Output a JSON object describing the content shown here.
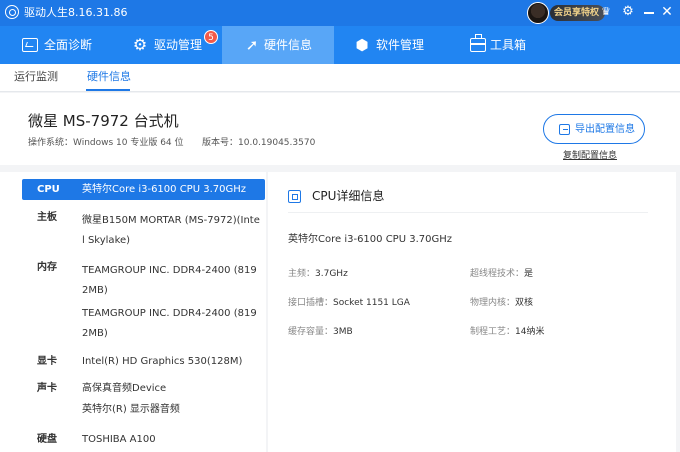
{
  "app": {
    "title": "驱动人生8.16.31.86",
    "vip_label": "会员享特权"
  },
  "nav": {
    "tabs": [
      {
        "label": "全面诊断",
        "icon": "monitor-check-icon"
      },
      {
        "label": "驱动管理",
        "icon": "gear-icon",
        "badge": "5"
      },
      {
        "label": "硬件信息",
        "icon": "rocket-icon",
        "active": true
      },
      {
        "label": "软件管理",
        "icon": "cube-icon"
      },
      {
        "label": "工具箱",
        "icon": "toolbox-icon"
      }
    ]
  },
  "subnav": {
    "tabs": [
      {
        "label": "运行监测"
      },
      {
        "label": "硬件信息",
        "active": true
      }
    ]
  },
  "device": {
    "title": "微星 MS-7972 台式机",
    "os": "操作系统：Windows 10 专业版 64 位",
    "version": "版本号：10.0.19045.3570",
    "export_label": "导出配置信息",
    "copy_label": "复制配置信息"
  },
  "hardware": {
    "cpu": {
      "category": "CPU",
      "value": "英特尔Core i3-6100 CPU 3.70GHz"
    },
    "motherboard": {
      "category": "主板",
      "value": "微星B150M MORTAR (MS-7972)(Intel Skylake)"
    },
    "memory": {
      "category": "内存",
      "values": [
        "TEAMGROUP INC. DDR4-2400 (8192MB)",
        "TEAMGROUP INC. DDR4-2400 (8192MB)"
      ]
    },
    "gpu": {
      "category": "显卡",
      "value": "Intel(R) HD Graphics 530(128M)"
    },
    "audio": {
      "category": "声卡",
      "values": [
        "高保真音频Device",
        "英特尔(R) 显示器音频"
      ]
    },
    "disk": {
      "category": "硬盘",
      "value": "TOSHIBA A100"
    }
  },
  "cpu_detail": {
    "title": "CPU详细信息",
    "name": "英特尔Core i3-6100 CPU 3.70GHz",
    "specs": {
      "freq": {
        "label": "主频：",
        "value": "3.7GHz"
      },
      "hyperthread": {
        "label": "超线程技术：",
        "value": "是"
      },
      "socket": {
        "label": "接口插槽：",
        "value": "Socket 1151 LGA"
      },
      "cores": {
        "label": "物理内核：",
        "value": "双核"
      },
      "cache": {
        "label": "缓存容量：",
        "value": "3MB"
      },
      "process": {
        "label": "制程工艺：",
        "value": "14纳米"
      }
    }
  }
}
